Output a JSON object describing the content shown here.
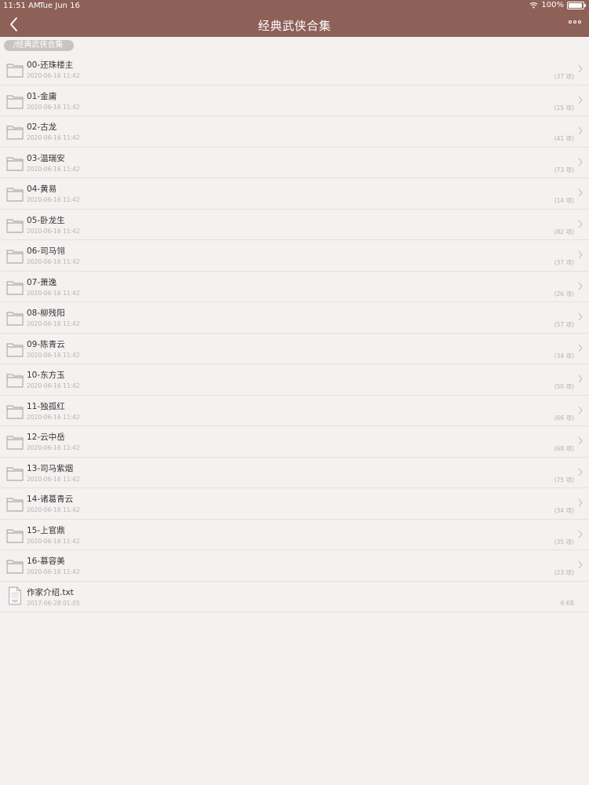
{
  "status_bar": {
    "time": "11:51 AM",
    "date": "Tue Jun 16",
    "battery": "100%"
  },
  "nav": {
    "title": "经典武侠合集"
  },
  "breadcrumb": "/经典武侠合集",
  "items": [
    {
      "name": "00-还珠楼主",
      "date": "2020-06-16 11:42",
      "meta": "(37 项)",
      "type": "folder"
    },
    {
      "name": "01-金庸",
      "date": "2020-06-16 11:42",
      "meta": "(15 项)",
      "type": "folder"
    },
    {
      "name": "02-古龙",
      "date": "2020-06-16 11:42",
      "meta": "(41 项)",
      "type": "folder"
    },
    {
      "name": "03-温瑞安",
      "date": "2020-06-16 11:42",
      "meta": "(73 项)",
      "type": "folder"
    },
    {
      "name": "04-黄易",
      "date": "2020-06-16 11:42",
      "meta": "(14 项)",
      "type": "folder"
    },
    {
      "name": "05-卧龙生",
      "date": "2020-06-16 11:42",
      "meta": "(82 项)",
      "type": "folder"
    },
    {
      "name": "06-司马翎",
      "date": "2020-06-16 11:42",
      "meta": "(37 项)",
      "type": "folder"
    },
    {
      "name": "07-萧逸",
      "date": "2020-06-16 11:42",
      "meta": "(26 项)",
      "type": "folder"
    },
    {
      "name": "08-柳残阳",
      "date": "2020-06-16 11:42",
      "meta": "(57 项)",
      "type": "folder"
    },
    {
      "name": "09-陈青云",
      "date": "2020-06-16 11:42",
      "meta": "(34 项)",
      "type": "folder"
    },
    {
      "name": "10-东方玉",
      "date": "2020-06-16 11:42",
      "meta": "(50 项)",
      "type": "folder"
    },
    {
      "name": "11-独孤红",
      "date": "2020-06-16 11:42",
      "meta": "(66 项)",
      "type": "folder"
    },
    {
      "name": "12-云中岳",
      "date": "2020-06-16 11:42",
      "meta": "(68 项)",
      "type": "folder"
    },
    {
      "name": "13-司马紫烟",
      "date": "2020-06-16 11:42",
      "meta": "(75 项)",
      "type": "folder"
    },
    {
      "name": "14-诸葛青云",
      "date": "2020-06-16 11:42",
      "meta": "(34 项)",
      "type": "folder"
    },
    {
      "name": "15-上官鼎",
      "date": "2020-06-16 11:42",
      "meta": "(35 项)",
      "type": "folder"
    },
    {
      "name": "16-慕容美",
      "date": "2020-06-16 11:42",
      "meta": "(23 项)",
      "type": "folder"
    },
    {
      "name": "作家介绍.txt",
      "date": "2017-06-28 01:05",
      "meta": "6 KB",
      "type": "file",
      "badge": "TXT"
    }
  ],
  "colors": {
    "header": "#8d6058",
    "background": "#f5f1f1",
    "breadcrumb": "#c9c4c3"
  },
  "icons": {
    "back": "chevron-left-icon",
    "more": "ellipsis-icon",
    "folder": "folder-icon",
    "file": "txt-file-icon",
    "row_arrow": "chevron-right-icon"
  }
}
